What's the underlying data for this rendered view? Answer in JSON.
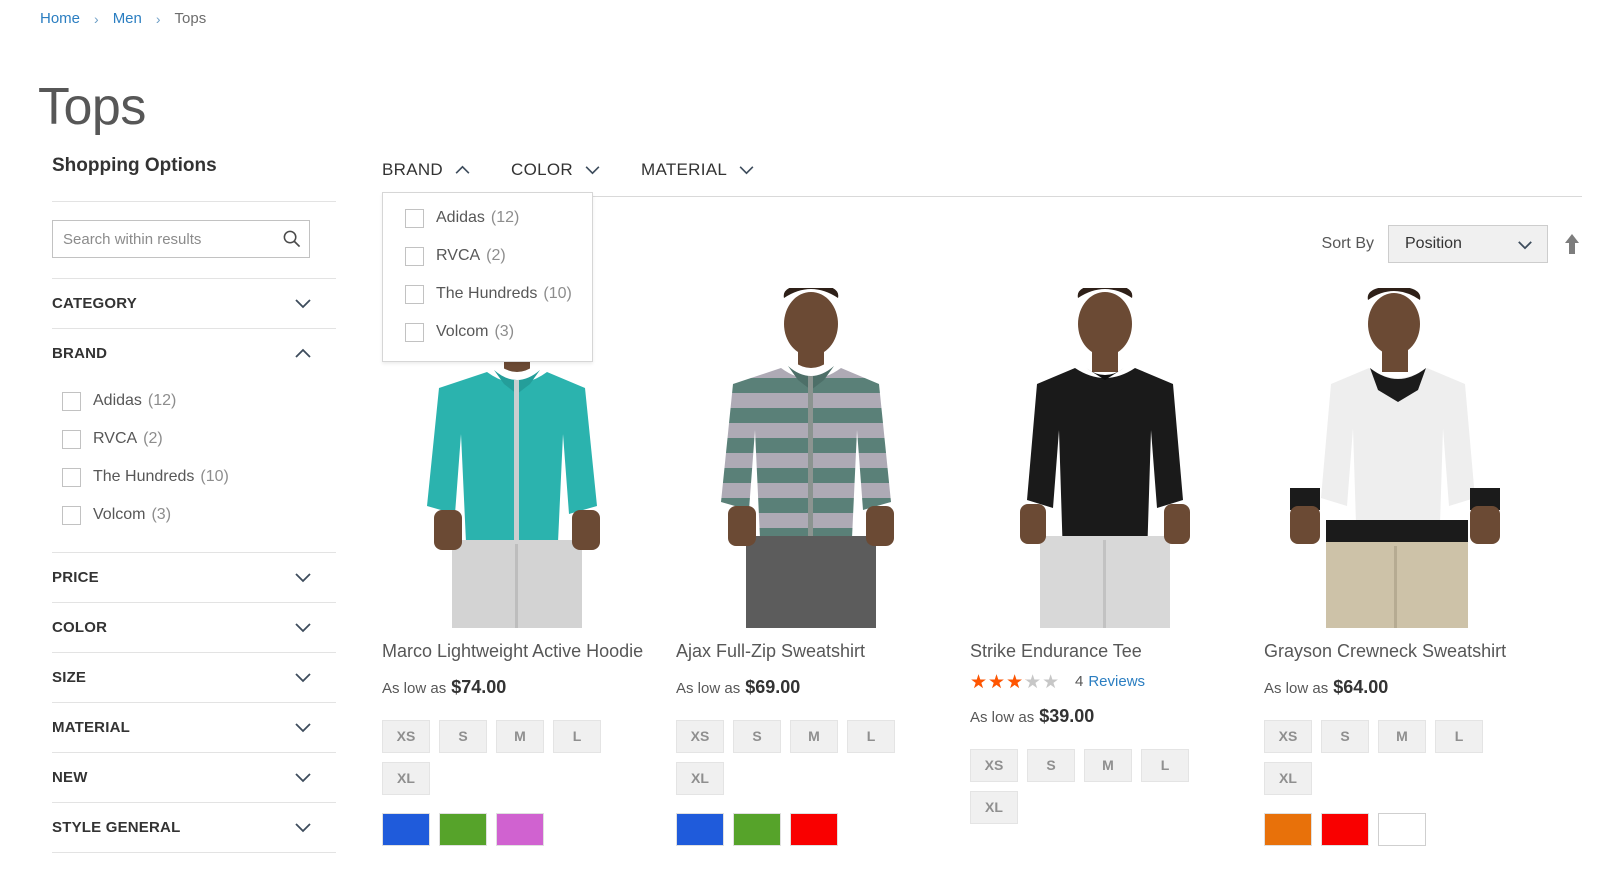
{
  "breadcrumb": {
    "items": [
      {
        "label": "Home",
        "link": true
      },
      {
        "label": "Men",
        "link": true
      },
      {
        "label": "Tops",
        "link": false
      }
    ],
    "separator": "›"
  },
  "page_title": "Tops",
  "sidebar": {
    "title": "Shopping Options",
    "search": {
      "placeholder": "Search within results",
      "value": "",
      "icon": "search-icon"
    },
    "filters": [
      {
        "label": "CATEGORY",
        "expanded": false,
        "options": []
      },
      {
        "label": "BRAND",
        "expanded": true,
        "options": [
          {
            "name": "Adidas",
            "count": "(12)",
            "checked": false
          },
          {
            "name": "RVCA",
            "count": "(2)",
            "checked": false
          },
          {
            "name": "The Hundreds",
            "count": "(10)",
            "checked": false
          },
          {
            "name": "Volcom",
            "count": "(3)",
            "checked": false
          }
        ]
      },
      {
        "label": "PRICE",
        "expanded": false,
        "options": []
      },
      {
        "label": "COLOR",
        "expanded": false,
        "options": []
      },
      {
        "label": "SIZE",
        "expanded": false,
        "options": []
      },
      {
        "label": "MATERIAL",
        "expanded": false,
        "options": []
      },
      {
        "label": "NEW",
        "expanded": false,
        "options": []
      },
      {
        "label": "STYLE GENERAL",
        "expanded": false,
        "options": []
      }
    ]
  },
  "horizontal_filters": [
    {
      "label": "BRAND",
      "expanded": true
    },
    {
      "label": "COLOR",
      "expanded": false
    },
    {
      "label": "MATERIAL",
      "expanded": false
    }
  ],
  "brand_dropdown": {
    "open": true,
    "options": [
      {
        "name": "Adidas",
        "count": "(12)",
        "checked": false
      },
      {
        "name": "RVCA",
        "count": "(2)",
        "checked": false
      },
      {
        "name": "The Hundreds",
        "count": "(10)",
        "checked": false
      },
      {
        "name": "Volcom",
        "count": "(3)",
        "checked": false
      }
    ]
  },
  "toolbar": {
    "sort_by_label": "Sort By",
    "sort_value": "Position",
    "sort_direction": "ascending"
  },
  "products": [
    {
      "name": "Marco Lightweight Active Hoodie",
      "price_prefix": "As low as",
      "price": "$74.00",
      "rating": null,
      "reviews": null,
      "sizes": [
        "XS",
        "S",
        "M",
        "L",
        "XL"
      ],
      "swatches": [
        "#1f5bdb",
        "#56a32a",
        "#d062d0"
      ]
    },
    {
      "name": "Ajax Full-Zip Sweatshirt",
      "price_prefix": "As low as",
      "price": "$69.00",
      "rating": null,
      "reviews": null,
      "sizes": [
        "XS",
        "S",
        "M",
        "L",
        "XL"
      ],
      "swatches": [
        "#1f5bdb",
        "#56a32a",
        "#f90000"
      ]
    },
    {
      "name": "Strike Endurance Tee",
      "price_prefix": "As low as",
      "price": "$39.00",
      "rating": 60,
      "reviews_count": "4",
      "reviews_label": "Reviews",
      "sizes": [
        "XS",
        "S",
        "M",
        "L",
        "XL"
      ],
      "swatches": []
    },
    {
      "name": "Grayson Crewneck Sweatshirt",
      "price_prefix": "As low as",
      "price": "$64.00",
      "rating": null,
      "reviews": null,
      "sizes": [
        "XS",
        "S",
        "M",
        "L",
        "XL"
      ],
      "swatches": [
        "#e8710a",
        "#f90000",
        "#ffffff"
      ]
    }
  ],
  "colors": {
    "link": "#2b7ec1",
    "star_filled": "#ff5501",
    "star_empty": "#c7c7c7",
    "text": "#575757"
  },
  "stars_glyphs": "★★★★★"
}
